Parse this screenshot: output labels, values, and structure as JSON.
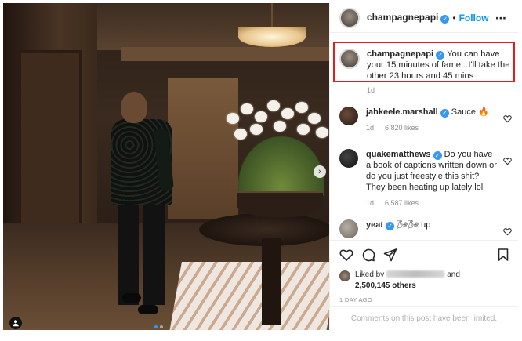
{
  "post": {
    "username": "champagnepapi",
    "follow_label": "Follow",
    "separator": "•",
    "more_icon": "⋯",
    "verified_mark": "✓",
    "caption": "You can have your 15 minutes of fame...I'll take the other 23 hours and 45 mins",
    "caption_time": "1d"
  },
  "comments": [
    {
      "username": "jahkeele.marshall",
      "text": "Sauce 🔥",
      "time": "1d",
      "likes": "6,820 likes",
      "verified": true
    },
    {
      "username": "quakematthews",
      "text": "Do you have a book of captions written down or do you just freestyle this shit? They been heating up lately lol",
      "time": "1d",
      "likes": "6,587 likes",
      "verified": true
    },
    {
      "username": "yeat",
      "text": "🌬🌬 up",
      "verified": true
    }
  ],
  "likes": {
    "prefix": "Liked by",
    "conjunction": "and",
    "count": "2,500,145 others"
  },
  "age": "1 DAY AGO",
  "comments_limited": "Comments on this post have been limited.",
  "icons": [
    "heart-icon",
    "comment-icon",
    "share-icon",
    "bookmark-icon",
    "next-arrow-icon",
    "tag-person-icon"
  ],
  "colors": {
    "verified": "#3897f0",
    "follow": "#0095f6",
    "highlight_border": "#e81b1b"
  }
}
